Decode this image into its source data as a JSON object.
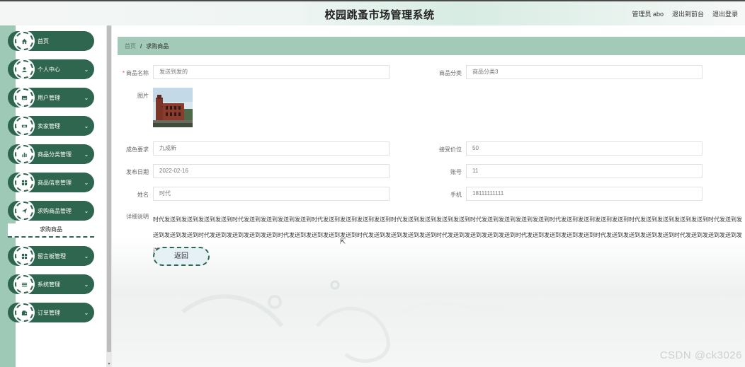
{
  "header": {
    "title": "校园跳蚤市场管理系统",
    "links": {
      "user": "管理员 abo",
      "front": "退出到前台",
      "logout": "退出登录"
    }
  },
  "sidebar": {
    "items": [
      {
        "label": "首页",
        "icon": "home-icon",
        "chevron": ""
      },
      {
        "label": "个人中心",
        "icon": "user-icon",
        "chevron": "⌄"
      },
      {
        "label": "用户管理",
        "icon": "image-icon",
        "chevron": "⌄"
      },
      {
        "label": "卖家管理",
        "icon": "ticket-icon",
        "chevron": "⌄"
      },
      {
        "label": "商品分类管理",
        "icon": "bar-chart-icon",
        "chevron": "⌄"
      },
      {
        "label": "商品信息管理",
        "icon": "grid-icon",
        "chevron": "⌄"
      },
      {
        "label": "求购商品管理",
        "icon": "send-icon",
        "chevron": "⌄"
      },
      {
        "label": "留言板管理",
        "icon": "grid-icon",
        "chevron": "⌄"
      },
      {
        "label": "系统管理",
        "icon": "list-icon",
        "chevron": "⌄"
      },
      {
        "label": "订单管理",
        "icon": "wallet-icon",
        "chevron": "⌄"
      }
    ],
    "submenu_active": "求购商品"
  },
  "breadcrumb": {
    "home": "首页",
    "separator": "/",
    "current": "求购商品"
  },
  "form": {
    "name_label": "商品名称",
    "name_value": "发送到发的",
    "category_label": "商品分类",
    "category_value": "商品分类3",
    "image_label": "图片",
    "condition_label": "成色要求",
    "condition_value": "九成新",
    "price_label": "接受价位",
    "price_value": "50",
    "date_label": "发布日期",
    "date_value": "2022-02-16",
    "account_label": "账号",
    "account_value": "11",
    "person_label": "姓名",
    "person_value": "时代",
    "phone_label": "手机",
    "phone_value": "18111111111",
    "desc_label": "详细说明",
    "desc_value": "时代发送到发送到发送到发送到时代发送到发送到发送到发送到时代发送到发送到发送到发送到时代发送到发送到发送到发送到时代发送到发送到发送到发送到时代发送到发送到发送到发送到时代发送到发送到发送到发送到时代发送到发送到发送到发送到时代发送到发送到发送到发送到时代发送到发送到发送到发送到时代发送到发送到发送到发送到时代发送到发送到发送到发送到时代发送到发送到发送到发送到时代发送到发送到发送到发送到时代发送到发送到发送到发送到",
    "back_label": "返回"
  },
  "watermark": "CSDN @ck3026",
  "colors": {
    "accent": "#2f6650",
    "rail": "#9ec9b6",
    "breadcrumb_bg": "#a3c9b8",
    "required": "#e05252"
  }
}
